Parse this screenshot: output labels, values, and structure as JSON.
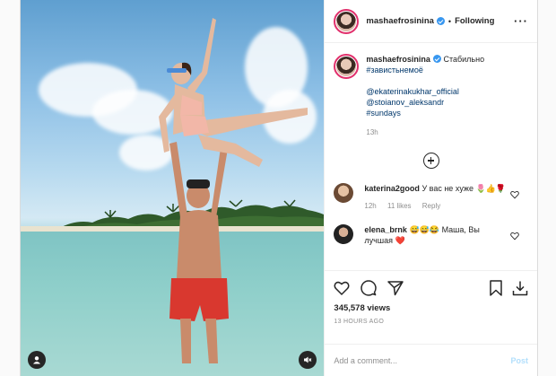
{
  "post": {
    "username": "mashaefrosinina",
    "following_label": "Following",
    "caption_text": "Стабильно",
    "caption_tags": [
      "#завистьнемоё",
      "@ekaterinakukhar_official",
      "@stoianov_aleksandr",
      "#sundays"
    ],
    "caption_time": "13h"
  },
  "comments": [
    {
      "username": "katerina2good",
      "text": "У вас не хуже 🌷👍🌹",
      "time": "12h",
      "likes": "11 likes",
      "reply": "Reply"
    },
    {
      "username": "elena_brnk",
      "text": "😅😅😂 Маша, Вы лучшая ❤️"
    }
  ],
  "stats": {
    "views": "345,578 views",
    "ago": "13 HOURS AGO"
  },
  "add_comment": {
    "placeholder": "Add a comment...",
    "post_label": "Post"
  },
  "colors": {
    "accent": "#0095f6",
    "story_ring": "#e1306c",
    "verified": "#3897f0",
    "link": "#00376b"
  },
  "icons": [
    "more-options-icon",
    "add-circle-icon",
    "heart-icon",
    "comment-icon",
    "share-icon",
    "bookmark-icon",
    "download-icon",
    "user-tag-icon",
    "mute-icon"
  ]
}
